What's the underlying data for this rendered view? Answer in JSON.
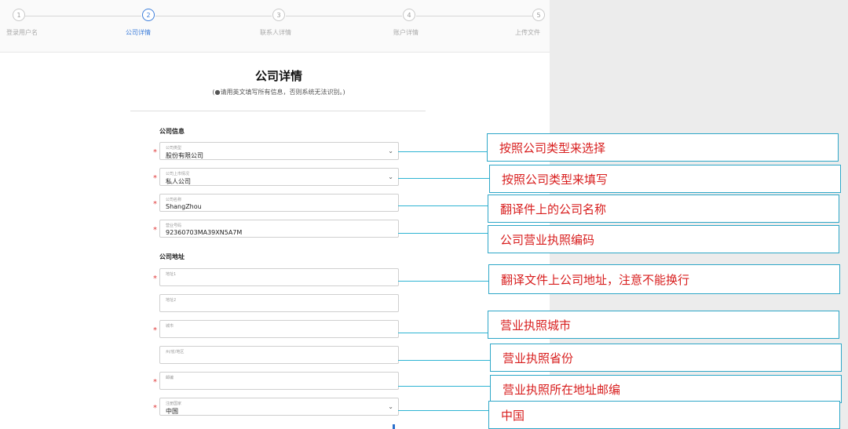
{
  "stepper": {
    "steps": [
      {
        "num": "1",
        "label": "登录用户名"
      },
      {
        "num": "2",
        "label": "公司详情"
      },
      {
        "num": "3",
        "label": "联系人详情"
      },
      {
        "num": "4",
        "label": "账户详情"
      },
      {
        "num": "5",
        "label": "上传文件"
      }
    ],
    "active_step": 2
  },
  "header": {
    "title": "公司详情",
    "note": "(●请用英文填写所有信息，否则系统无法识别。)"
  },
  "company_info": {
    "section_title": "公司信息",
    "company_type": {
      "label": "公司类型",
      "value": "股份有限公司"
    },
    "listing_status": {
      "label": "公司上市情况",
      "value": "私人公司"
    },
    "company_name": {
      "label": "公司名称",
      "value": "ShangZhou"
    },
    "license_number": {
      "label": "营业号码",
      "value": "92360703MA39XN5A7M"
    }
  },
  "company_address": {
    "section_title": "公司地址",
    "address1": {
      "label": "地址1",
      "value": ""
    },
    "address2": {
      "label": "地址2",
      "value": ""
    },
    "city": {
      "label": "城市",
      "value": ""
    },
    "province": {
      "label": "州/省/地区",
      "value": ""
    },
    "postal_code": {
      "label": "邮编",
      "value": ""
    },
    "country": {
      "label": "注册国家",
      "value": "中国"
    }
  },
  "annotations": [
    "按照公司类型来选择",
    "按照公司类型来填写",
    "翻译件上的公司名称",
    "公司营业执照编码",
    "翻译文件上公司地址，注意不能换行",
    "营业执照城市",
    "营业执照省份",
    "营业执照所在地址邮编",
    "中国"
  ],
  "colors": {
    "required": "#e03a3a",
    "accent": "#3d7edb",
    "annotation_text": "#d81e1e",
    "connector": "#2eb4d3"
  }
}
